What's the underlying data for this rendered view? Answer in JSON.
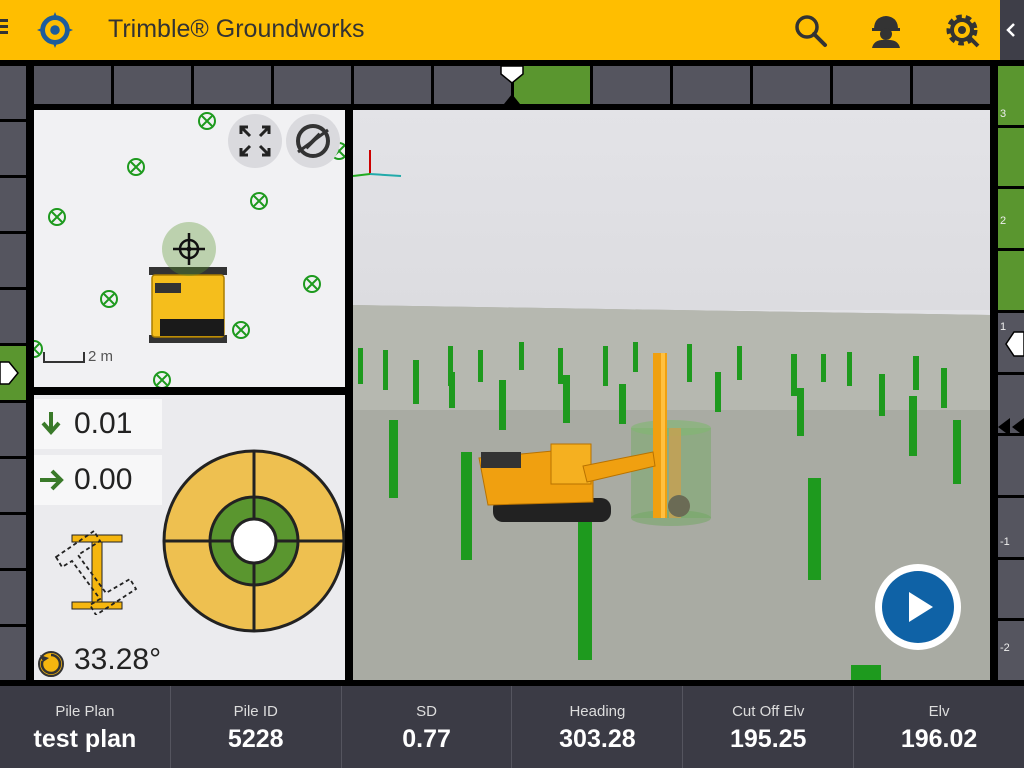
{
  "header": {
    "title": "Trimble® Groundworks",
    "icons": [
      "menu-icon",
      "trimble-logo-icon",
      "search-icon",
      "operator-icon",
      "settings-icon",
      "collapse-icon"
    ],
    "accent": "#FFBE00"
  },
  "plan": {
    "scale_label": "2 m"
  },
  "guidance": {
    "vertical_offset": "0.01",
    "horizontal_offset": "0.00",
    "rotation": "33.28°"
  },
  "elevation_rail": {
    "ticks": [
      "3",
      "2",
      "1",
      "-1",
      "-2"
    ]
  },
  "footer": {
    "items": [
      {
        "label": "Pile Plan",
        "value": "test plan"
      },
      {
        "label": "Pile ID",
        "value": "5228"
      },
      {
        "label": "SD",
        "value": "0.77"
      },
      {
        "label": "Heading",
        "value": "303.28"
      },
      {
        "label": "Cut Off Elv",
        "value": "195.25"
      },
      {
        "label": "Elv",
        "value": "196.02"
      }
    ]
  },
  "colors": {
    "pile_green": "#1E9A1E",
    "machine_orange": "#F0A010",
    "target_yellow": "#EEC050",
    "active_green": "#5A962F",
    "play_blue": "#0F62A6"
  }
}
